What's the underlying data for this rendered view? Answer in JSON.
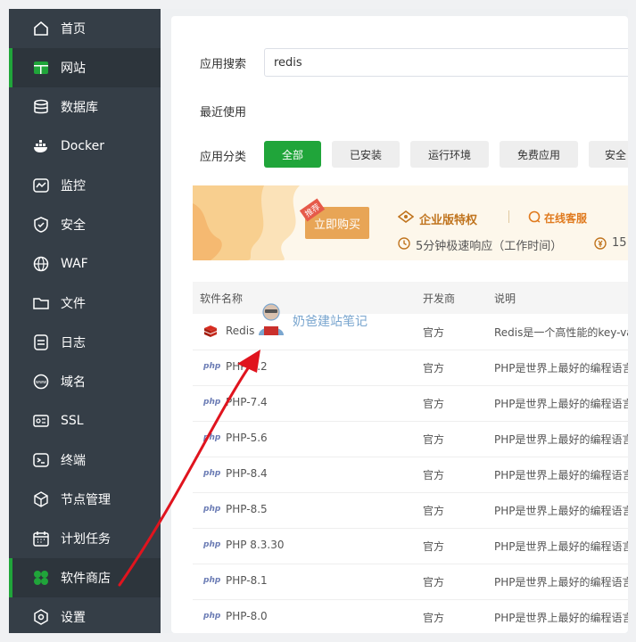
{
  "sidebar": {
    "items": [
      {
        "label": "首页",
        "icon": "home-icon"
      },
      {
        "label": "网站",
        "icon": "website-icon"
      },
      {
        "label": "数据库",
        "icon": "database-icon"
      },
      {
        "label": "Docker",
        "icon": "docker-icon"
      },
      {
        "label": "监控",
        "icon": "monitor-icon"
      },
      {
        "label": "安全",
        "icon": "shield-icon"
      },
      {
        "label": "WAF",
        "icon": "globe-icon"
      },
      {
        "label": "文件",
        "icon": "folder-icon"
      },
      {
        "label": "日志",
        "icon": "log-icon"
      },
      {
        "label": "域名",
        "icon": "domain-icon"
      },
      {
        "label": "SSL",
        "icon": "ssl-icon"
      },
      {
        "label": "终端",
        "icon": "terminal-icon"
      },
      {
        "label": "节点管理",
        "icon": "cube-icon"
      },
      {
        "label": "计划任务",
        "icon": "calendar-icon"
      },
      {
        "label": "软件商店",
        "icon": "clover-icon"
      },
      {
        "label": "设置",
        "icon": "gear-icon"
      }
    ],
    "active": "网站",
    "highlight": "软件商店"
  },
  "search": {
    "label": "应用搜索",
    "value": "redis"
  },
  "recent": {
    "label": "最近使用"
  },
  "categories": {
    "label": "应用分类",
    "items": [
      "全部",
      "已安装",
      "运行环境",
      "免费应用",
      "安全"
    ]
  },
  "banner": {
    "tag": "推荐",
    "buy": "立即购买",
    "title": "企业版特权",
    "service": "在线客服",
    "response": "5分钟极速响应（工作时间）",
    "extra": "15"
  },
  "table": {
    "headers": [
      "软件名称",
      "开发商",
      "说明"
    ],
    "rows": [
      {
        "name": "Redis",
        "vendor": "官方",
        "desc": "Redis是一个高性能的key-value",
        "icon": "redis-icon"
      },
      {
        "name": "PHP-8.2",
        "vendor": "官方",
        "desc": "PHP是世界上最好的编程语言",
        "icon": "php"
      },
      {
        "name": "PHP-7.4",
        "vendor": "官方",
        "desc": "PHP是世界上最好的编程语言",
        "icon": "php"
      },
      {
        "name": "PHP-5.6",
        "vendor": "官方",
        "desc": "PHP是世界上最好的编程语言",
        "icon": "php"
      },
      {
        "name": "PHP-8.4",
        "vendor": "官方",
        "desc": "PHP是世界上最好的编程语言",
        "icon": "php"
      },
      {
        "name": "PHP-8.5",
        "vendor": "官方",
        "desc": "PHP是世界上最好的编程语言",
        "icon": "php"
      },
      {
        "name": "PHP 8.3.30",
        "vendor": "官方",
        "desc": "PHP是世界上最好的编程语言",
        "icon": "php"
      },
      {
        "name": "PHP-8.1",
        "vendor": "官方",
        "desc": "PHP是世界上最好的编程语言",
        "icon": "php"
      },
      {
        "name": "PHP-8.0",
        "vendor": "官方",
        "desc": "PHP是世界上最好的编程语言",
        "icon": "php"
      }
    ]
  },
  "php_icon_text": "php",
  "watermark": "奶爸建站笔记",
  "colors": {
    "sidebar": "#353e47",
    "accent": "#20a53a",
    "arrow": "#e0141e"
  }
}
